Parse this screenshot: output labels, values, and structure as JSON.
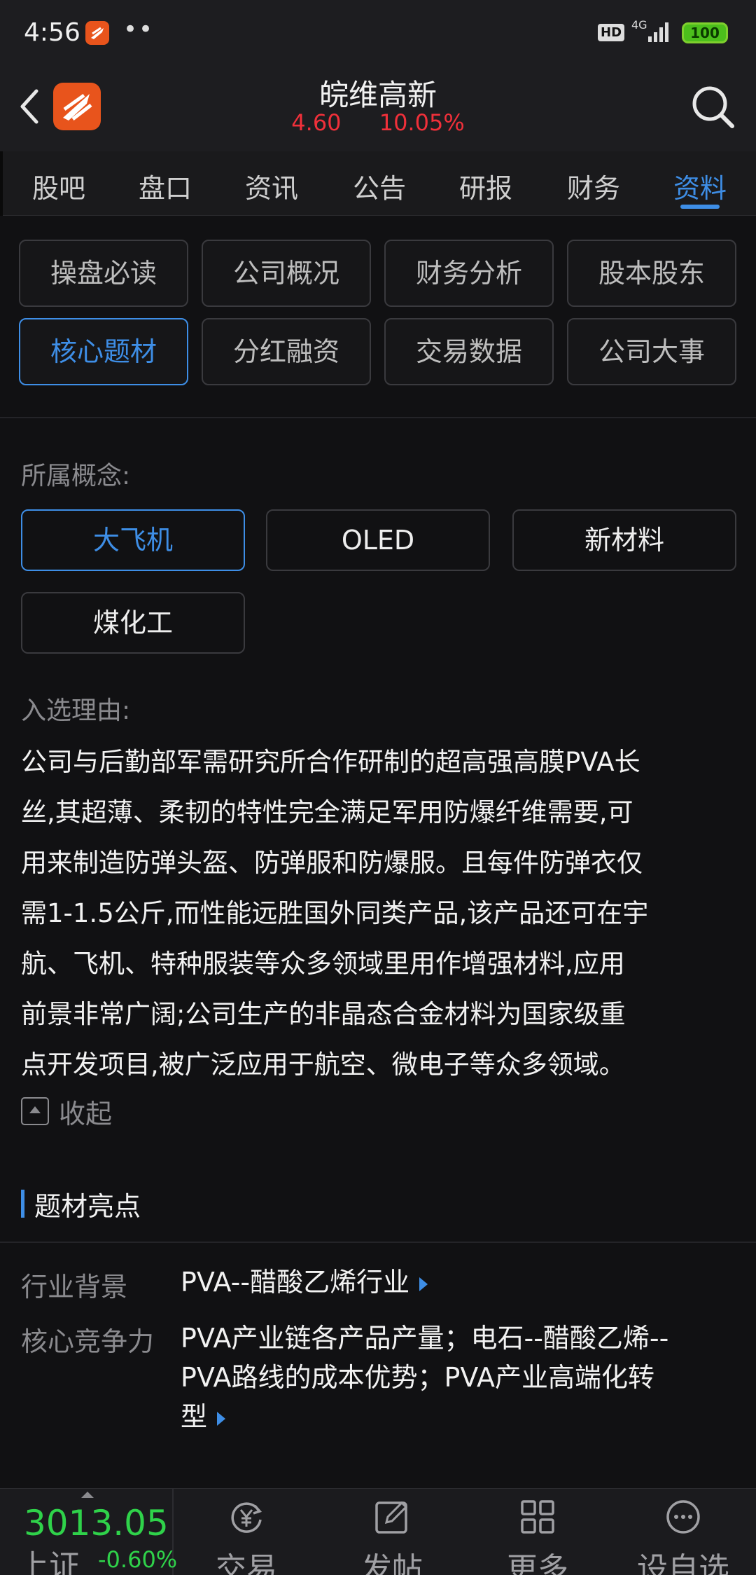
{
  "status_bar": {
    "time": "4:56",
    "dots": "••",
    "hd": "HD",
    "network": "4G",
    "battery": "100"
  },
  "header": {
    "stock_name": "皖维高新",
    "price": "4.60",
    "change_pct": "10.05%"
  },
  "tabs": [
    {
      "label": "股吧"
    },
    {
      "label": "盘口"
    },
    {
      "label": "资讯"
    },
    {
      "label": "公告"
    },
    {
      "label": "研报"
    },
    {
      "label": "财务"
    },
    {
      "label": "资料",
      "active": true
    }
  ],
  "sections": [
    {
      "label": "操盘必读"
    },
    {
      "label": "公司概况"
    },
    {
      "label": "财务分析"
    },
    {
      "label": "股本股东"
    },
    {
      "label": "核心题材",
      "active": true
    },
    {
      "label": "分红融资"
    },
    {
      "label": "交易数据"
    },
    {
      "label": "公司大事"
    }
  ],
  "concepts": {
    "label": "所属概念:",
    "items": [
      {
        "label": "大飞机",
        "active": true
      },
      {
        "label": "OLED"
      },
      {
        "label": "新材料"
      },
      {
        "label": "煤化工"
      }
    ]
  },
  "reason": {
    "label": "入选理由:",
    "lines": [
      "公司与后勤部军需研究所合作研制的超高强高膜PVA长",
      "丝,其超薄、柔韧的特性完全满足军用防爆纤维需要,可",
      "用来制造防弹头盔、防弹服和防爆服。且每件防弹衣仅",
      "需1-1.5公斤,而性能远胜国外同类产品,该产品还可在宇",
      "航、飞机、特种服装等众多领域里用作增强材料,应用",
      "前景非常广阔;公司生产的非晶态合金材料为国家级重",
      "点开发项目,被广泛应用于航空、微电子等众多领域。"
    ],
    "collapse_label": "收起"
  },
  "highlights": {
    "title": "题材亮点",
    "rows": [
      {
        "key": "行业背景",
        "value_lines": [
          "PVA--醋酸乙烯行业"
        ]
      },
      {
        "key": "核心竞争力",
        "value_lines": [
          "PVA产业链各产品产量；电石--醋酸乙烯--",
          "PVA路线的成本优势；PVA产业高端化转",
          "型"
        ]
      }
    ]
  },
  "bottom_bar": {
    "index_value": "3013.05",
    "index_name": "上证",
    "index_change": "-0.60%",
    "nav": [
      {
        "label": "交易",
        "icon": "yen-cycle-icon"
      },
      {
        "label": "发帖",
        "icon": "edit-icon"
      },
      {
        "label": "更多",
        "icon": "grid-icon"
      },
      {
        "label": "设自选",
        "icon": "more-dots-icon"
      }
    ]
  },
  "colors": {
    "accent": "#3e8ee6",
    "up": "#f0303a",
    "down": "#2fd24a",
    "background": "#111113"
  }
}
